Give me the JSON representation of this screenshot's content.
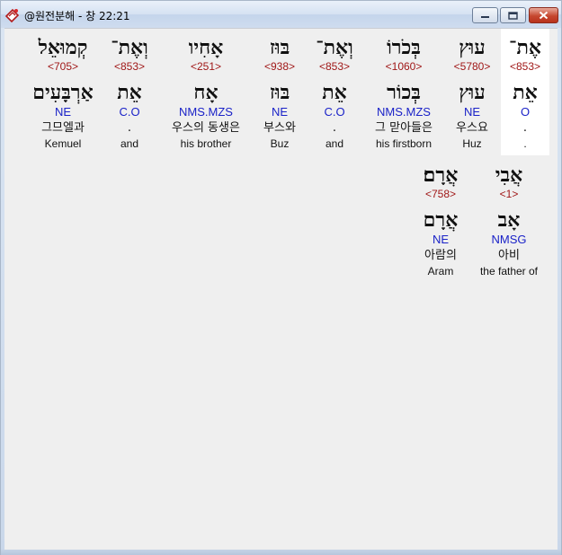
{
  "window": {
    "title": "@원전분해 - 창 22:21"
  },
  "words": [
    {
      "heb": "אֶת־",
      "num": "<853>",
      "root": "אֵת",
      "code": "O",
      "kor": ".",
      "eng": "."
    },
    {
      "heb": "עוּץ",
      "num": "<5780>",
      "root": "עוּץ",
      "code": "NE",
      "kor": "우스요",
      "eng": "Huz"
    },
    {
      "heb": "בְּכֹרוֹ",
      "num": "<1060>",
      "root": "בְּכוֹר",
      "code": "NMS.MZS",
      "kor": "그 맏아들은",
      "eng": "his firstborn"
    },
    {
      "heb": "וְאֶת־",
      "num": "<853>",
      "root": "אֵת",
      "code": "C.O",
      "kor": ".",
      "eng": "and"
    },
    {
      "heb": "בּוּז",
      "num": "<938>",
      "root": "בּוּז",
      "code": "NE",
      "kor": "부스와",
      "eng": "Buz"
    },
    {
      "heb": "אָחִיו",
      "num": "<251>",
      "root": "אָח",
      "code": "NMS.MZS",
      "kor": "우스의 동생은",
      "eng": "his brother"
    },
    {
      "heb": "וְאֶת־",
      "num": "<853>",
      "root": "אֵת",
      "code": "C.O",
      "kor": ".",
      "eng": "and"
    },
    {
      "heb": "קְמוּאֵל",
      "num": "<705>",
      "root": "אַרְבָּעִים",
      "code": "NE",
      "kor": "그므엘과",
      "eng": "Kemuel"
    },
    {
      "heb": "אֲבִי",
      "num": "<1>",
      "root": "אָב",
      "code": "NMSG",
      "kor": "아비",
      "eng": "the father of"
    },
    {
      "heb": "אֲרָם׃",
      "num": "<758>",
      "root": "אֲרָם",
      "code": "NE",
      "kor": "아람의",
      "eng": "Aram"
    }
  ]
}
